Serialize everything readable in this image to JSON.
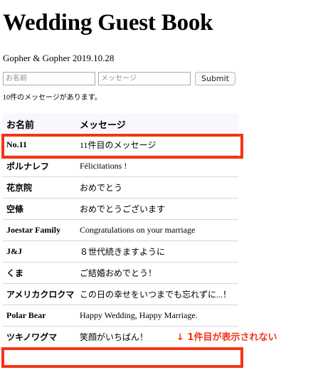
{
  "header": {
    "title": "Wedding Guest Book",
    "subtitle": "Gopher & Gopher 2019.10.28"
  },
  "form": {
    "name_placeholder": "お名前",
    "message_placeholder": "メッセージ",
    "submit_label": "Submit"
  },
  "count_text": "10件のメッセージがあります。",
  "table": {
    "headers": [
      "お名前",
      "メッセージ"
    ],
    "rows": [
      {
        "name": "No.11",
        "message": "11件目のメッセージ"
      },
      {
        "name": "ポルナレフ",
        "message": "Félicitations !"
      },
      {
        "name": "花京院",
        "message": "おめでとう"
      },
      {
        "name": "空條",
        "message": "おめでとうございます"
      },
      {
        "name": "Joestar Family",
        "message": "Congratulations on your marriage"
      },
      {
        "name": "J&J",
        "message": "８世代続きますように"
      },
      {
        "name": "くま",
        "message": "ご結婚おめでとう！"
      },
      {
        "name": "アメリカクロクマ",
        "message": "この日の幸せをいつまでも忘れずに...！"
      },
      {
        "name": "Polar Bear",
        "message": "Happy Wedding, Happy Marriage."
      },
      {
        "name": "ツキノワグマ",
        "message": "笑顔がいちばん！"
      }
    ]
  },
  "annotation": {
    "text": "↓ 1件目が表示されない",
    "color": "#f53418"
  }
}
